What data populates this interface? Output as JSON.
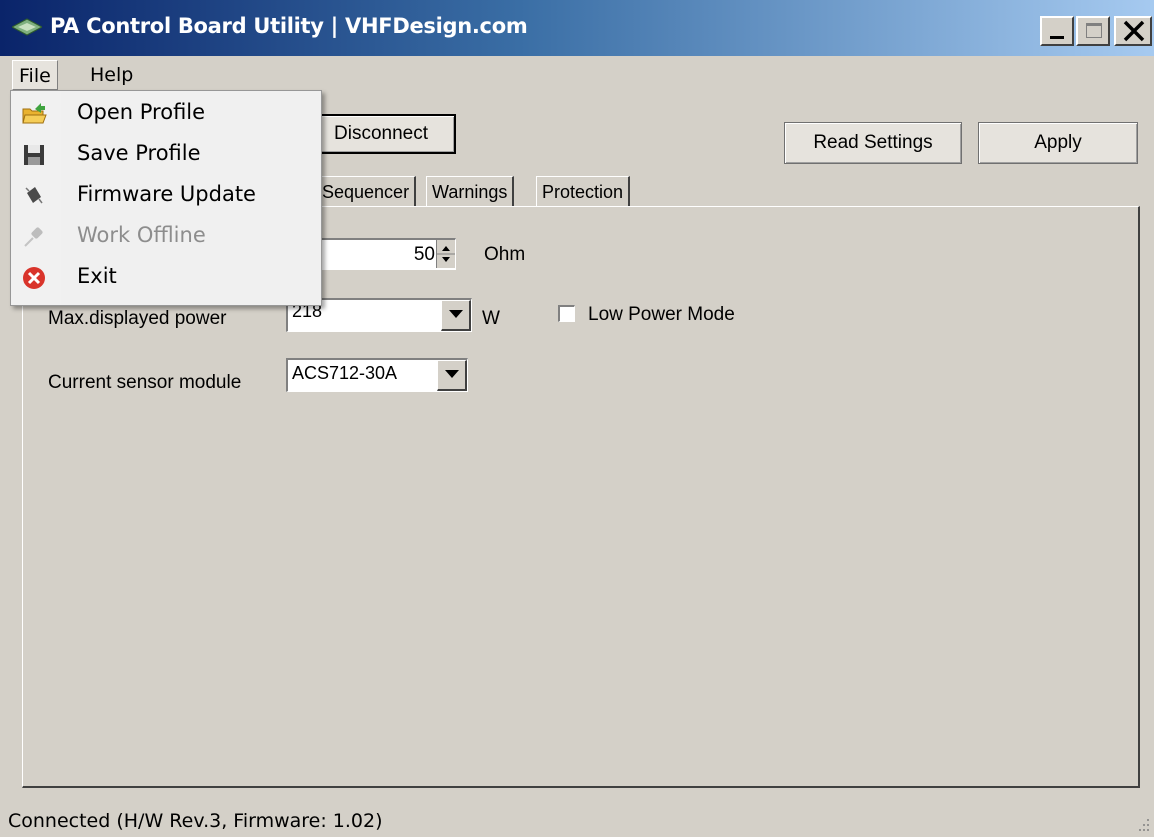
{
  "window": {
    "title": "PA Control Board Utility | VHFDesign.com",
    "controls": {
      "minimize": "_",
      "maximize": "□",
      "close": "X"
    }
  },
  "menubar": {
    "items": [
      {
        "label": "File"
      },
      {
        "label": "Help"
      }
    ]
  },
  "file_menu": {
    "items": [
      {
        "label": "Open Profile",
        "icon": "open-folder-icon",
        "enabled": true
      },
      {
        "label": "Save Profile",
        "icon": "floppy-disk-icon",
        "enabled": true
      },
      {
        "label": "Firmware Update",
        "icon": "chip-icon",
        "enabled": true
      },
      {
        "label": "Work Offline",
        "icon": "plug-icon",
        "enabled": false
      },
      {
        "label": "Exit",
        "icon": "exit-icon",
        "enabled": true
      }
    ]
  },
  "toolbar": {
    "disconnect_label": "Disconnect",
    "read_settings_label": "Read Settings",
    "apply_label": "Apply"
  },
  "tabs": [
    {
      "label": "Sequencer"
    },
    {
      "label": "Warnings"
    },
    {
      "label": "Protection"
    }
  ],
  "settings": {
    "impedance": {
      "value": "50",
      "unit": "Ohm"
    },
    "max_power": {
      "label": "Max.displayed power",
      "value": "218",
      "unit": "W"
    },
    "low_power_mode": {
      "label": "Low Power Mode",
      "checked": false
    },
    "current_sensor": {
      "label": "Current sensor module",
      "value": "ACS712-30A"
    }
  },
  "status": {
    "text": "Connected (H/W Rev.3, Firmware: 1.02)"
  },
  "colors": {
    "titlebar_start": "#0a246a",
    "titlebar_end": "#a6caf0",
    "face": "#d4d0c8"
  }
}
